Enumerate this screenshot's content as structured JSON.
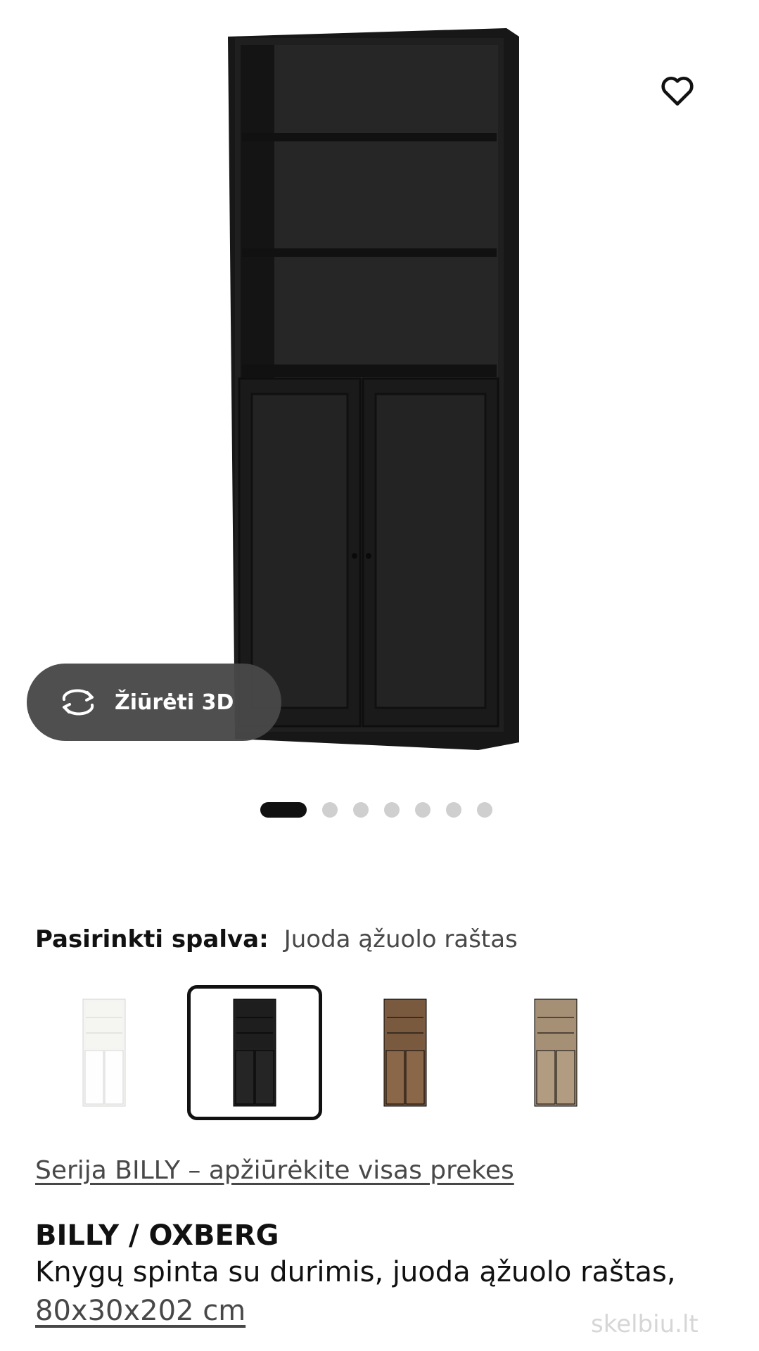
{
  "gallery": {
    "favorite_icon": "heart-icon",
    "view_3d_label": "Žiūrėti 3D",
    "view_3d_icon": "rotate-arrows-icon",
    "dots_count": 7,
    "active_dot_index": 0
  },
  "color_picker": {
    "label": "Pasirinkti spalva:",
    "selected_value": "Juoda ąžuolo raštas",
    "selected_index": 1,
    "options": [
      {
        "color": "#f4f4f2",
        "door": "#ffffff"
      },
      {
        "color": "#1f1f1f",
        "door": "#262626"
      },
      {
        "color": "#7a5a40",
        "door": "#8a6849"
      },
      {
        "color": "#a58f76",
        "door": "#b29c82"
      }
    ]
  },
  "series_link": "Serija BILLY – apžiūrėkite visas prekes",
  "product": {
    "name": "BILLY / OXBERG",
    "description": "Knygų spinta su durimis, juoda ąžuolo raštas,",
    "size": "80x30x202 cm"
  },
  "watermark": "skelbiu.lt",
  "colors": {
    "text": "#111111",
    "muted": "#484848",
    "dot_inactive": "#cfcfcf",
    "button_bg": "#484848",
    "bookcase": "#1e1e1e"
  }
}
